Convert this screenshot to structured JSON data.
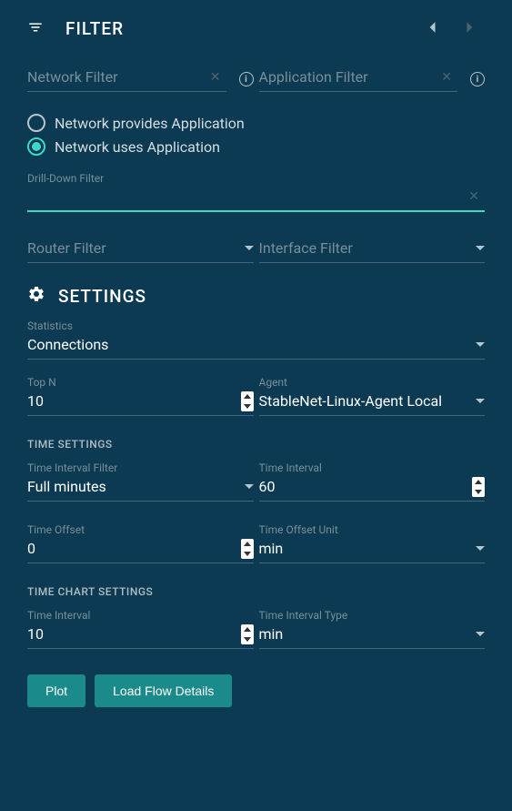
{
  "filter": {
    "title": "FILTER",
    "network_filter": {
      "label": "Network Filter",
      "value": ""
    },
    "application_filter": {
      "label": "Application Filter",
      "value": ""
    },
    "radio": {
      "option1": "Network provides Application",
      "option2": "Network uses Application",
      "selected": "option2"
    },
    "drill_down": {
      "label": "Drill-Down Filter",
      "value": ""
    },
    "router_filter": {
      "label": "Router Filter",
      "value": ""
    },
    "interface_filter": {
      "label": "Interface Filter",
      "value": ""
    }
  },
  "settings": {
    "title": "SETTINGS",
    "statistics": {
      "label": "Statistics",
      "value": "Connections"
    },
    "top_n": {
      "label": "Top N",
      "value": "10"
    },
    "agent": {
      "label": "Agent",
      "value": "StableNet-Linux-Agent Local"
    },
    "time_settings_title": "TIME SETTINGS",
    "time_interval_filter": {
      "label": "Time Interval Filter",
      "value": "Full minutes"
    },
    "time_interval": {
      "label": "Time Interval",
      "value": "60"
    },
    "time_offset": {
      "label": "Time Offset",
      "value": "0"
    },
    "time_offset_unit": {
      "label": "Time Offset Unit",
      "value": "min"
    },
    "time_chart_title": "TIME CHART SETTINGS",
    "chart_interval": {
      "label": "Time Interval",
      "value": "10"
    },
    "chart_interval_type": {
      "label": "Time Interval Type",
      "value": "min"
    }
  },
  "buttons": {
    "plot": "Plot",
    "load_flow": "Load Flow Details"
  }
}
